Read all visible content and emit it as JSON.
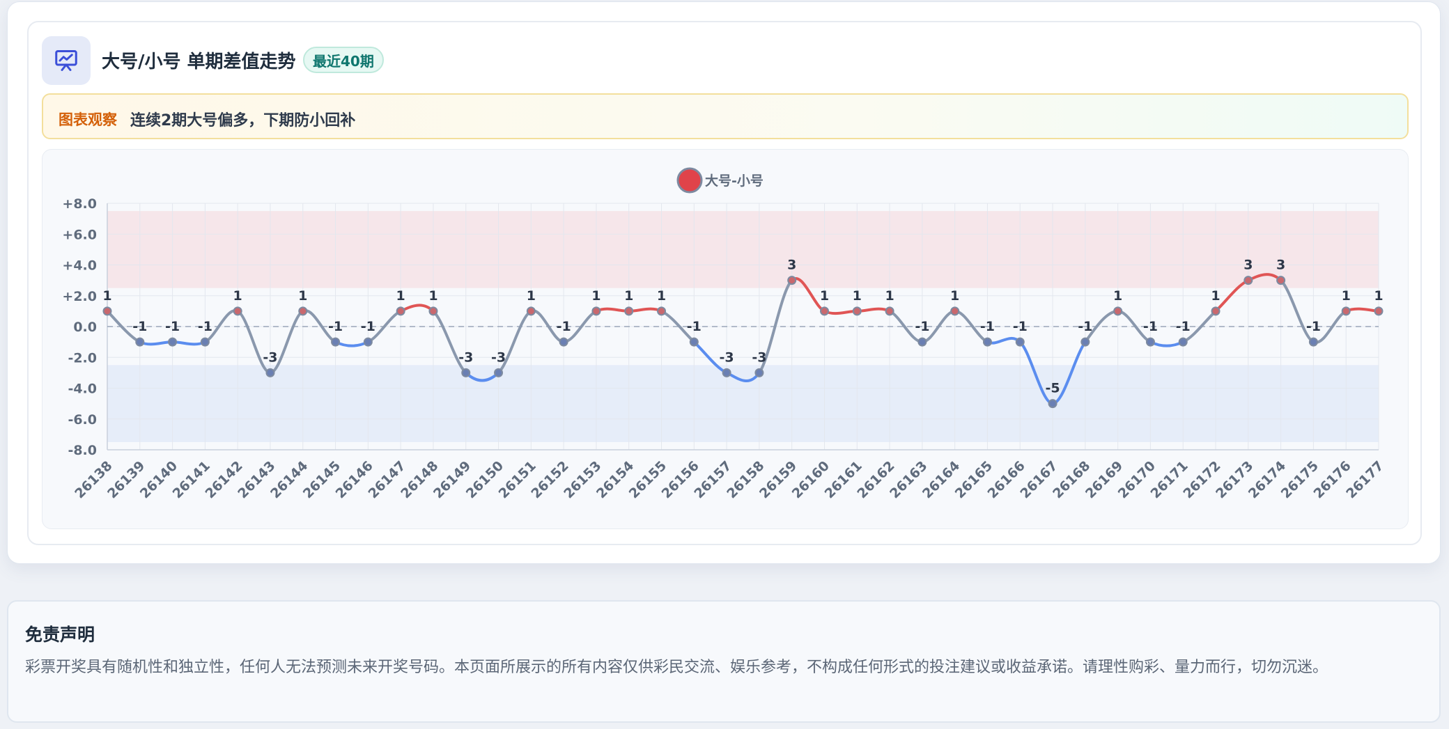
{
  "header": {
    "title": "大号/小号 单期差值走势",
    "badge": "最近40期",
    "icon": "chart-presentation-icon"
  },
  "note": {
    "tag": "图表观察",
    "text": "连续2期大号偏多，下期防小回补"
  },
  "disclaimer": {
    "title": "免责声明",
    "text": "彩票开奖具有随机性和独立性，任何人无法预测未来开奖号码。本页面所展示的所有内容仅供彩民交流、娱乐参考，不构成任何形式的投注建议或收益承诺。请理性购彩、量力而行，切勿沉迷。"
  },
  "colors": {
    "positive": "#e05555",
    "negative": "#5b8def",
    "neutral": "#8a98ad",
    "legend_dot": "#e0434a",
    "band_high": "#f6e6ea",
    "band_low": "#e6edf9"
  },
  "chart_data": {
    "type": "line",
    "title": "",
    "xlabel": "",
    "ylabel": "",
    "legend": {
      "label": "大号-小号",
      "position": "top-center"
    },
    "ylim": [
      -8,
      8
    ],
    "yticks": [
      "+8.0",
      "+6.0",
      "+4.0",
      "+2.0",
      "0.0",
      "-2.0",
      "-4.0",
      "-6.0",
      "-8.0"
    ],
    "ytick_values": [
      8,
      6,
      4,
      2,
      0,
      -2,
      -4,
      -6,
      -8
    ],
    "bands": [
      {
        "from": 2.5,
        "to": 7.5,
        "meaning": "high"
      },
      {
        "from": -7.5,
        "to": -2.5,
        "meaning": "low"
      }
    ],
    "zero_line": "dashed",
    "grid": true,
    "smooth": true,
    "categories": [
      "26138",
      "26139",
      "26140",
      "26141",
      "26142",
      "26143",
      "26144",
      "26145",
      "26146",
      "26147",
      "26148",
      "26149",
      "26150",
      "26151",
      "26152",
      "26153",
      "26154",
      "26155",
      "26156",
      "26157",
      "26158",
      "26159",
      "26160",
      "26161",
      "26162",
      "26163",
      "26164",
      "26165",
      "26166",
      "26167",
      "26168",
      "26169",
      "26170",
      "26171",
      "26172",
      "26173",
      "26174",
      "26175",
      "26176",
      "26177"
    ],
    "series": [
      {
        "name": "大号-小号",
        "values": [
          1,
          -1,
          -1,
          -1,
          1,
          -3,
          1,
          -1,
          -1,
          1,
          1,
          -3,
          -3,
          1,
          -1,
          1,
          1,
          1,
          -1,
          -3,
          -3,
          3,
          1,
          1,
          1,
          -1,
          1,
          -1,
          -1,
          -5,
          -1,
          1,
          -1,
          -1,
          1,
          3,
          3,
          -1,
          1,
          1
        ]
      }
    ],
    "data_labels": [
      "1",
      "-1",
      "-1",
      "-1",
      "1",
      "-3",
      "1",
      "-1",
      "-1",
      "1",
      "1",
      "-3",
      "-3",
      "1",
      "-1",
      "1",
      "1",
      "1",
      "-1",
      "-3",
      "-3",
      "3",
      "1",
      "1",
      "1",
      "-1",
      "1",
      "-1",
      "-1",
      "-5",
      "-1",
      "1",
      "-1",
      "-1",
      "1",
      "3",
      "3",
      "-1",
      "1",
      "1"
    ]
  }
}
